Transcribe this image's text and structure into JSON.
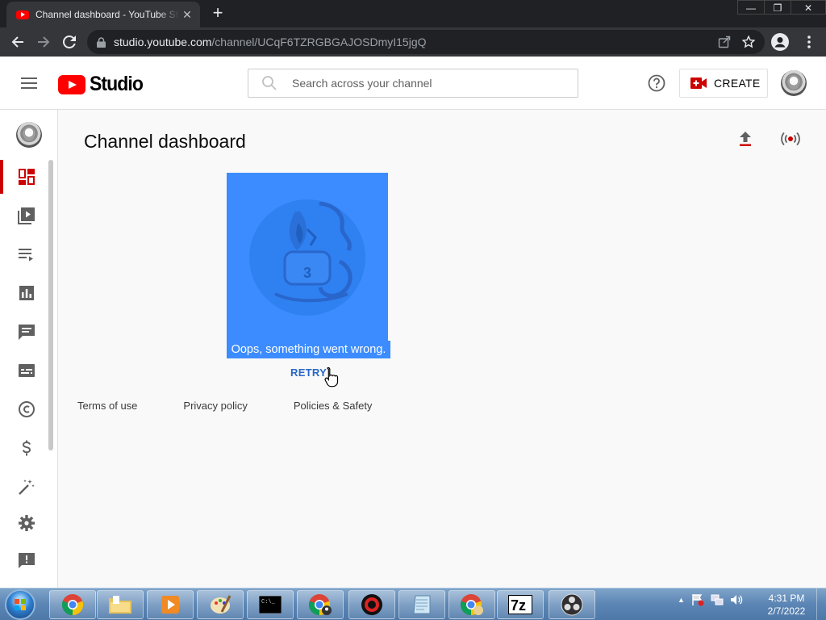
{
  "browser": {
    "tab_title": "Channel dashboard - YouTube Studio",
    "tab_close": "✕",
    "new_tab": "+",
    "url_host": "studio.youtube.com",
    "url_path": "/channel/UCqF6TZRGBGAJOSDmyI15jgQ",
    "window_controls": {
      "minimize": "—",
      "restore": "❐",
      "close": "✕"
    }
  },
  "header": {
    "logo_text": "Studio",
    "search_placeholder": "Search across your channel",
    "create_label": "CREATE"
  },
  "sidebar": {
    "items": [
      {
        "name": "dashboard",
        "icon": "dashboard-icon",
        "active": true
      },
      {
        "name": "content",
        "icon": "content-icon"
      },
      {
        "name": "playlists",
        "icon": "playlists-icon"
      },
      {
        "name": "analytics",
        "icon": "analytics-icon"
      },
      {
        "name": "comments",
        "icon": "comments-icon"
      },
      {
        "name": "subtitles",
        "icon": "subtitles-icon"
      },
      {
        "name": "copyright",
        "icon": "copyright-icon"
      },
      {
        "name": "monetization",
        "icon": "dollar-icon"
      },
      {
        "name": "customization",
        "icon": "magic-wand-icon"
      },
      {
        "name": "settings",
        "icon": "gear-icon"
      },
      {
        "name": "feedback",
        "icon": "feedback-icon"
      }
    ]
  },
  "main": {
    "page_title": "Channel dashboard",
    "error_message": "Oops, something went wrong.",
    "retry_label": "RETRY",
    "footer_links": [
      "Terms of use",
      "Privacy policy",
      "Policies & Safety"
    ]
  },
  "taskbar": {
    "apps": [
      "chrome",
      "file-explorer",
      "media-player",
      "paint",
      "command-prompt",
      "chrome-profile",
      "obs-recorder",
      "notepad",
      "chrome-alt",
      "7zip",
      "obs-studio"
    ],
    "time": "4:31 PM",
    "date": "2/7/2022",
    "tray_arrow": "▲"
  },
  "colors": {
    "accent_red": "#cc0000",
    "youtube_red": "#ff0000",
    "error_bg": "#3c8cff",
    "retry_blue": "#2a66c7"
  }
}
